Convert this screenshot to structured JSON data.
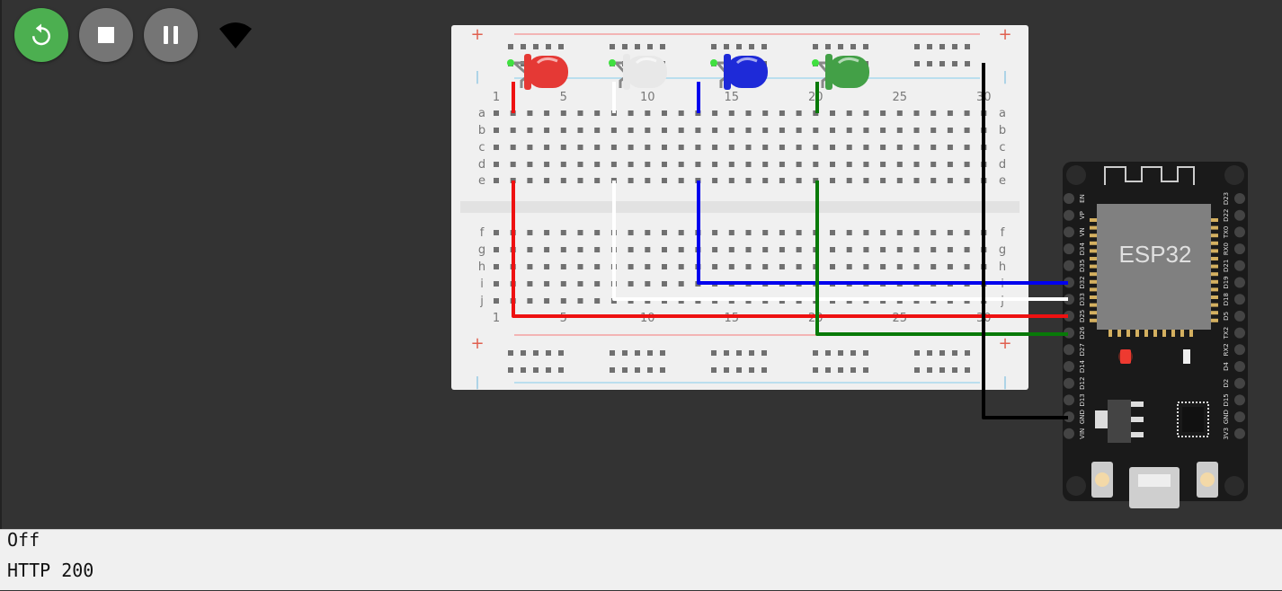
{
  "toolbar": {
    "restart_icon": "restart-icon",
    "stop_icon": "stop-icon",
    "pause_icon": "pause-icon",
    "wifi_icon": "wifi-icon"
  },
  "breadboard": {
    "column_labels_top": [
      "1",
      "5",
      "10",
      "15",
      "20",
      "25",
      "30"
    ],
    "column_labels_bottom": [
      "1",
      "5",
      "10",
      "15",
      "20",
      "25",
      "30"
    ],
    "row_labels_top": [
      "a",
      "b",
      "c",
      "d",
      "e"
    ],
    "row_labels_bottom": [
      "f",
      "g",
      "h",
      "i",
      "j"
    ],
    "rail_plus": "+",
    "rail_minus": "|"
  },
  "leds": [
    {
      "color": "red",
      "fill": "#e53935"
    },
    {
      "color": "white",
      "fill": "#e8e8e8"
    },
    {
      "color": "blue",
      "fill": "#1e2ad8"
    },
    {
      "color": "green",
      "fill": "#43a047"
    }
  ],
  "wire_colors": {
    "red": "#ee1111",
    "white": "#ffffff",
    "blue": "#0000ee",
    "green": "#087a08",
    "black": "#000000"
  },
  "esp32": {
    "chip_label": "ESP32",
    "left_pins": [
      "EN",
      "VP",
      "VN",
      "D34",
      "D35",
      "D32",
      "D33",
      "D25",
      "D26",
      "D27",
      "D14",
      "D12",
      "D13",
      "GND",
      "VIN"
    ],
    "right_pins": [
      "D23",
      "D22",
      "TX0",
      "RX0",
      "D21",
      "D19",
      "D18",
      "D5",
      "TX2",
      "RX2",
      "D4",
      "D2",
      "D15",
      "GND",
      "3V3"
    ]
  },
  "serial": {
    "lines": [
      "Off",
      "HTTP 200"
    ]
  }
}
